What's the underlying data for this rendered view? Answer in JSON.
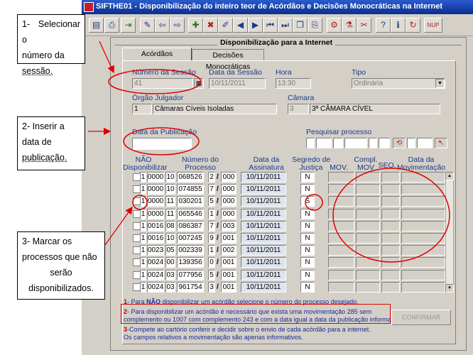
{
  "window": {
    "title": "SIFTHE01 - Disponibilização do inteiro teor de Acórdãos e Decisões Monocráticas na Internet"
  },
  "toolbar": {
    "icons": [
      "save-icon",
      "print-icon",
      "exit-icon",
      "tools-icon",
      "back-icon",
      "forward-icon",
      "new-record-icon",
      "delete-record-icon",
      "edit-icon",
      "prev-icon",
      "next-icon",
      "first-icon",
      "last-icon",
      "copy-icon",
      "paste-icon",
      "export-icon",
      "filter-icon",
      "clear-icon",
      "help-icon",
      "info-icon",
      "refresh-icon",
      "nup-icon"
    ]
  },
  "panel": {
    "title": "Disponibilização para a Internet",
    "tabs": [
      "Acórdãos",
      "Decisões Monocráticas"
    ]
  },
  "form": {
    "numero_sessao": {
      "label": "Número da Sessão",
      "value": "41"
    },
    "data_sessao": {
      "label": "Data da Sessão",
      "value": "10/11/2011"
    },
    "hora": {
      "label": "Hora",
      "value": "13:30"
    },
    "tipo": {
      "label": "Tipo",
      "value": "Ordinária"
    },
    "orgao": {
      "label": "Órgão Julgador",
      "code": "1",
      "value": "Câmaras Cíveis Isoladas"
    },
    "camara": {
      "label": "Câmara",
      "code": "3",
      "value": "3ª CÂMARA CÍVEL"
    },
    "data_publicacao": {
      "label": "Data da Publicação",
      "value": ""
    },
    "pesquisar": {
      "label": "Pesquisar  processo"
    }
  },
  "table": {
    "headers": {
      "nao": "NÃO\nDisponibilizar",
      "numero": "Número do\nProcesso",
      "data_assinatura": "Data da\nAssinatura",
      "segredo": "Segredo de\nJustiça",
      "mov": "MOV.",
      "compl": "Compl.\nMOV",
      "seq": "SEQ.",
      "data_mov": "Data da\nMovimentação"
    },
    "rows": [
      {
        "a": "1",
        "b": "0000",
        "c": "10",
        "d": "068526",
        "e": "2",
        "f": "000",
        "date": "10/11/2011",
        "s": "N"
      },
      {
        "a": "1",
        "b": "0000",
        "c": "10",
        "d": "074855",
        "e": "7",
        "f": "000",
        "date": "10/11/2011",
        "s": "N"
      },
      {
        "a": "1",
        "b": "0000",
        "c": "11",
        "d": "030201",
        "e": "5",
        "f": "000",
        "date": "10/11/2011",
        "s": "S"
      },
      {
        "a": "1",
        "b": "0000",
        "c": "11",
        "d": "065546",
        "e": "1",
        "f": "000",
        "date": "10/11/2011",
        "s": "N"
      },
      {
        "a": "1",
        "b": "0016",
        "c": "08",
        "d": "086387",
        "e": "7",
        "f": "003",
        "date": "10/11/2011",
        "s": "N"
      },
      {
        "a": "1",
        "b": "0016",
        "c": "10",
        "d": "007245",
        "e": "9",
        "f": "001",
        "date": "10/11/2011",
        "s": "N"
      },
      {
        "a": "1",
        "b": "0023",
        "c": "05",
        "d": "002339",
        "e": "1",
        "f": "002",
        "date": "10/11/2011",
        "s": "N"
      },
      {
        "a": "1",
        "b": "0024",
        "c": "00",
        "d": "139356",
        "e": "0",
        "f": "001",
        "date": "10/11/2011",
        "s": "N"
      },
      {
        "a": "1",
        "b": "0024",
        "c": "03",
        "d": "077956",
        "e": "5",
        "f": "001",
        "date": "10/11/2011",
        "s": "N"
      },
      {
        "a": "1",
        "b": "0024",
        "c": "03",
        "d": "961754",
        "e": "3",
        "f": "001",
        "date": "10/11/2011",
        "s": "N"
      }
    ]
  },
  "notes": {
    "n1_a": "1",
    "n1_b": "- Para ",
    "n1_c": "NÃO",
    "n1_d": " disponibilizar um acórdão selecione o número do processo desejado.",
    "n2_a": "2",
    "n2_b": "- Para disponibilizar um acórdão é necessário que exista uma movimentação 285 sem",
    "n2_c": "complemento ou 1007 com complemento 243 e com a data igual a data da publicação informada.",
    "n3_a": "3",
    "n3_b": "-Compete ao cartório conferir e decidir sobre o envio de cada acórdão para a internet.",
    "n3_c": "Os campos relativos a movimentação são apenas informativos."
  },
  "buttons": {
    "confirmar": "CONFIRMAR"
  },
  "callouts": {
    "c1_line1": "1- Selecionar o",
    "c1_line2": "número da",
    "c1_line3": "sessão.",
    "c2_line1": "2- Inserir a",
    "c2_line2": "data de",
    "c2_line3": "publicação.",
    "c3_line1": "3- Marcar os",
    "c3_line2": "processos que não",
    "c3_line3": "serão",
    "c3_line4": "disponibilizados."
  },
  "colors": {
    "annotation": "#e00000",
    "label": "#1a3a8a",
    "title_bar": "#0a2e8c"
  }
}
